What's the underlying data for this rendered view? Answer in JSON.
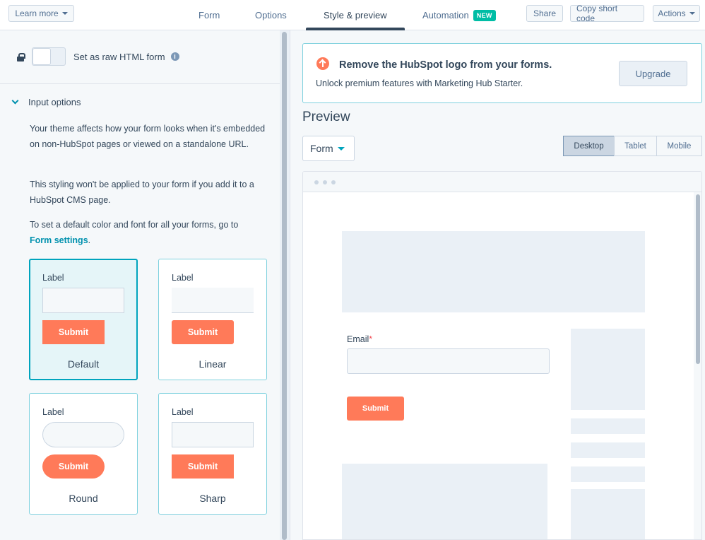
{
  "topbar": {
    "learn_more": "Learn more",
    "tabs": [
      {
        "label": "Form"
      },
      {
        "label": "Options"
      },
      {
        "label": "Style & preview"
      },
      {
        "label": "Automation",
        "badge": "NEW"
      }
    ],
    "share": "Share",
    "copy_short_code": "Copy short code",
    "actions": "Actions"
  },
  "left": {
    "raw_html_label": "Set as raw HTML form",
    "info_glyph": "i",
    "section_title": "Input options",
    "para1": "Your theme affects how your form looks when it's embedded on non-HubSpot pages or viewed on a standalone URL.",
    "para2": "This styling won't be applied to your form if you add it to a HubSpot CMS page.",
    "para3": "To set a default color and font for all your forms, go to",
    "form_settings_link": "Form settings",
    "para3_end": ".",
    "styles": [
      {
        "name": "Default",
        "label": "Label",
        "submit": "Submit"
      },
      {
        "name": "Linear",
        "label": "Label",
        "submit": "Submit"
      },
      {
        "name": "Round",
        "label": "Label",
        "submit": "Submit"
      },
      {
        "name": "Sharp",
        "label": "Label",
        "submit": "Submit"
      }
    ]
  },
  "right": {
    "banner_title": "Remove the HubSpot logo from your forms.",
    "banner_sub": "Unlock premium features with Marketing Hub Starter.",
    "upgrade": "Upgrade",
    "preview_title": "Preview",
    "form_dropdown": "Form",
    "devices": [
      "Desktop",
      "Tablet",
      "Mobile"
    ],
    "email_label": "Email",
    "required_mark": "*",
    "submit": "Submit"
  },
  "colors": {
    "accent": "#00a4bd",
    "submit": "#ff7a59",
    "badge": "#00bda5",
    "text": "#33475b"
  }
}
